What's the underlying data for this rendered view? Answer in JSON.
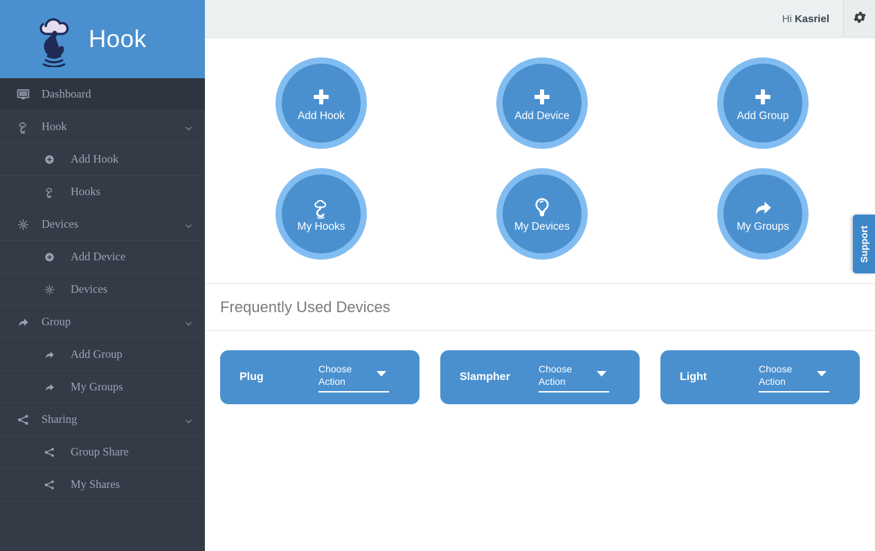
{
  "brand": {
    "title": "Hook",
    "logo_icon": "cloud-hook-logo"
  },
  "topbar": {
    "greeting_prefix": "Hi",
    "user_name": "Kasriel",
    "settings_icon": "gear-icon"
  },
  "sidebar": {
    "items": [
      {
        "label": "Dashboard",
        "icon": "monitor-icon",
        "level": "top",
        "active": true,
        "chevron": false
      },
      {
        "label": "Hook",
        "icon": "cloud-hook-icon",
        "level": "top",
        "active": false,
        "chevron": true
      },
      {
        "label": "Add Hook",
        "icon": "plus-circle-icon",
        "level": "sub",
        "active": false,
        "chevron": false
      },
      {
        "label": "Hooks",
        "icon": "cloud-hook-icon",
        "level": "sub",
        "active": false,
        "chevron": false
      },
      {
        "label": "Devices",
        "icon": "device-sun-icon",
        "level": "top",
        "active": false,
        "chevron": true
      },
      {
        "label": "Add Device",
        "icon": "plus-circle-icon",
        "level": "sub",
        "active": false,
        "chevron": false
      },
      {
        "label": "Devices",
        "icon": "device-sun-icon",
        "level": "sub",
        "active": false,
        "chevron": false
      },
      {
        "label": "Group",
        "icon": "share-arrow-icon",
        "level": "top",
        "active": false,
        "chevron": true
      },
      {
        "label": "Add Group",
        "icon": "share-arrow-icon",
        "level": "sub",
        "active": false,
        "chevron": false
      },
      {
        "label": "My Groups",
        "icon": "share-arrow-icon",
        "level": "sub",
        "active": false,
        "chevron": false
      },
      {
        "label": "Sharing",
        "icon": "share-nodes-icon",
        "level": "top",
        "active": false,
        "chevron": true
      },
      {
        "label": "Group Share",
        "icon": "share-nodes-icon",
        "level": "sub",
        "active": false,
        "chevron": false
      },
      {
        "label": "My Shares",
        "icon": "share-nodes-icon",
        "level": "sub",
        "active": false,
        "chevron": false
      }
    ]
  },
  "shortcuts": {
    "row1": [
      {
        "label": "Add Hook",
        "icon": "plus-icon"
      },
      {
        "label": "Add Device",
        "icon": "plus-icon"
      },
      {
        "label": "Add Group",
        "icon": "plus-icon"
      }
    ],
    "row2": [
      {
        "label": "My Hooks",
        "icon": "cloud-hook-icon"
      },
      {
        "label": "My Devices",
        "icon": "lightbulb-icon"
      },
      {
        "label": "My Groups",
        "icon": "share-arrow-icon"
      }
    ]
  },
  "frequently_used": {
    "heading": "Frequently Used Devices",
    "devices": [
      {
        "name": "Plug",
        "action_label": "Choose Action",
        "caret_icon": "caret-down-icon"
      },
      {
        "name": "Slampher",
        "action_label": "Choose Action",
        "caret_icon": "caret-down-icon"
      },
      {
        "name": "Light",
        "action_label": "Choose Action",
        "caret_icon": "caret-down-icon"
      }
    ]
  },
  "support": {
    "label": "Support"
  },
  "colors": {
    "brand_blue": "#4a90cf",
    "ring_blue": "#82bdf2",
    "sidebar_dark": "#343a46",
    "topbar_gray": "#ecf0f1"
  }
}
